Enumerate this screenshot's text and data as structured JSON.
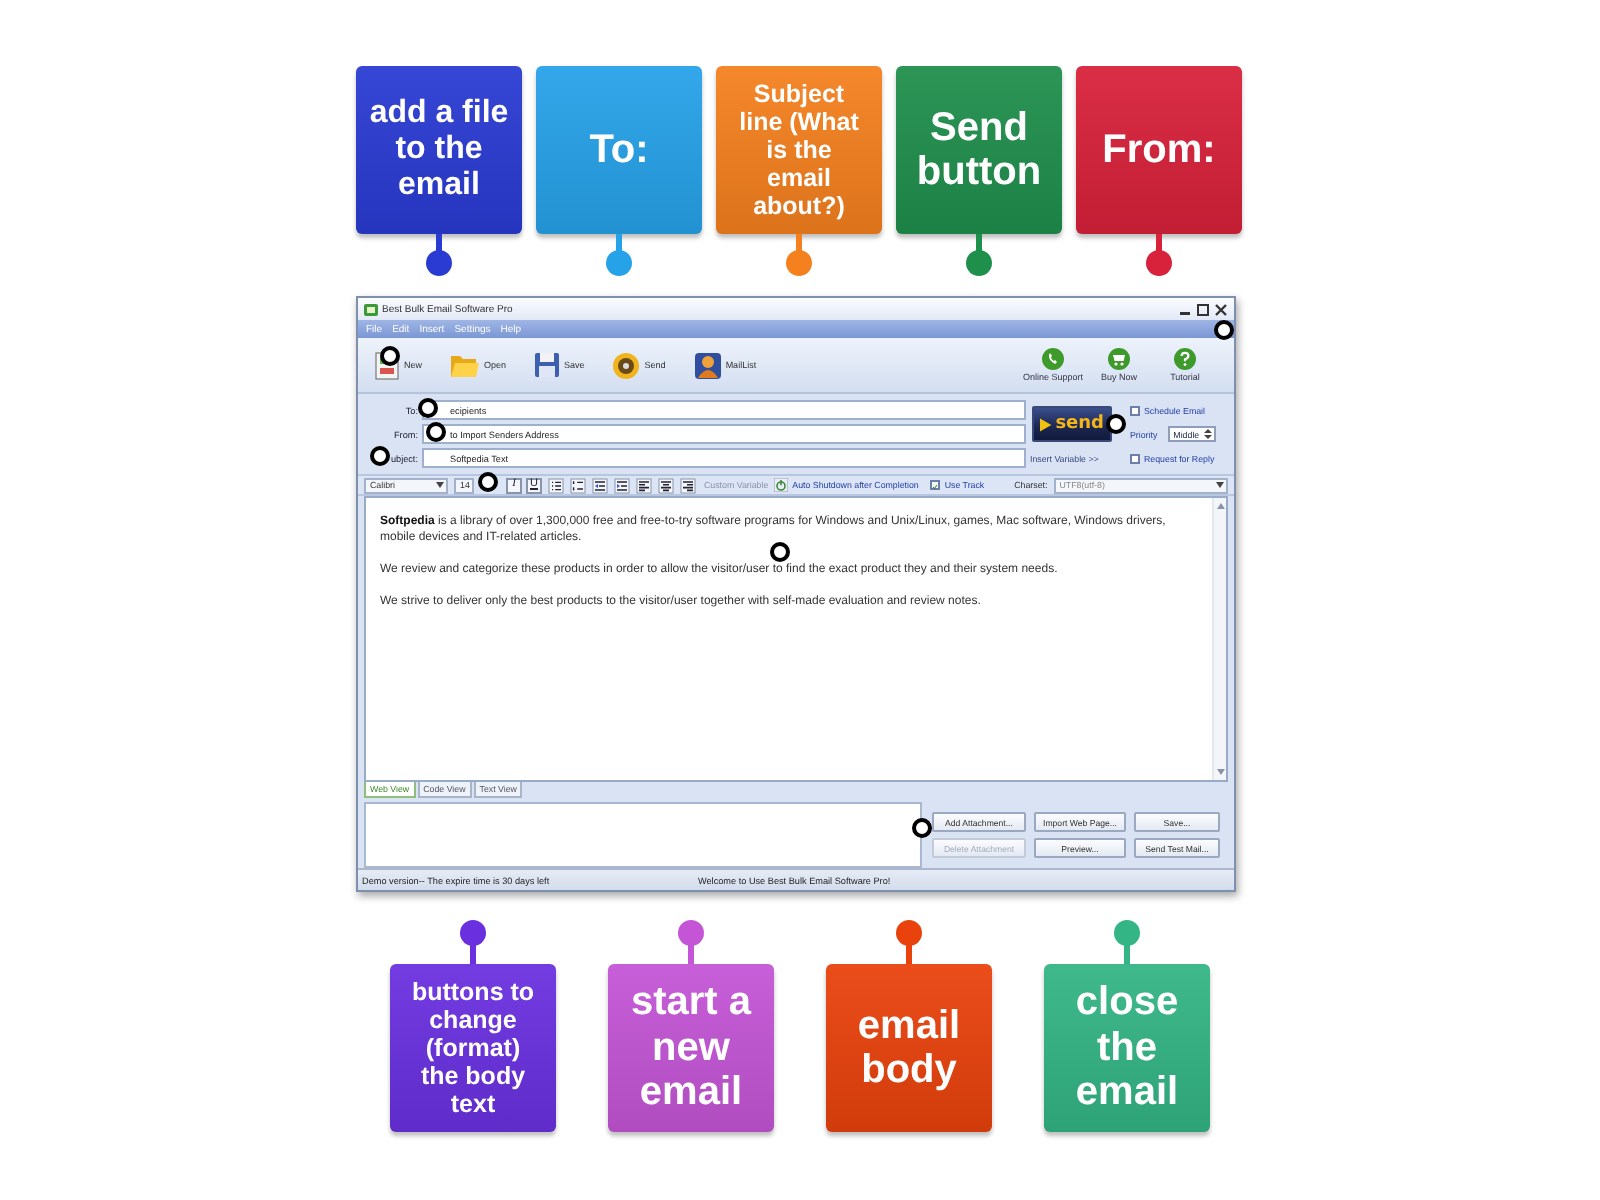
{
  "top_labels": [
    {
      "text": "add a file to the email",
      "color": "#2a3bd3"
    },
    {
      "text": "To:",
      "color": "#26a2e9"
    },
    {
      "text": "Subject line (What is the email about?)",
      "color": "#f5801e"
    },
    {
      "text": "Send button",
      "color": "#1f8f4c"
    },
    {
      "text": "From:",
      "color": "#d8213a"
    }
  ],
  "window": {
    "title": "Best Bulk Email Software Pro",
    "menu": [
      "File",
      "Edit",
      "Insert",
      "Settings",
      "Help"
    ],
    "toolbar": [
      {
        "kind": "new",
        "label": "New"
      },
      {
        "kind": "open",
        "label": "Open"
      },
      {
        "kind": "save",
        "label": "Save"
      },
      {
        "kind": "send",
        "label": "Send"
      },
      {
        "kind": "maillist",
        "label": "MailList"
      }
    ],
    "toolbar_right": [
      {
        "kind": "support",
        "label": "Online Support"
      },
      {
        "kind": "buy",
        "label": "Buy Now"
      },
      {
        "kind": "tutorial",
        "label": "Tutorial"
      }
    ],
    "fields": [
      {
        "label": "To:",
        "value": "ecipients"
      },
      {
        "label": "From:",
        "value": "to Import Senders Address"
      },
      {
        "label": "ubject:",
        "value": "Softpedia Text"
      }
    ],
    "send_button": "send",
    "insert_variable": "Insert Variable >>",
    "options": {
      "schedule": {
        "label": "Schedule Email",
        "checked": false
      },
      "priority_label": "Priority",
      "priority": "Middle",
      "request_reply": {
        "label": "Request for Reply",
        "checked": false
      }
    },
    "format_bar": {
      "font": "Calibri",
      "size": "14",
      "buttons": [
        {
          "kind": "italic",
          "label": "I"
        },
        {
          "kind": "underline",
          "label": "U"
        },
        {
          "kind": "bullets"
        },
        {
          "kind": "numbering"
        },
        {
          "kind": "outdent"
        },
        {
          "kind": "indent"
        },
        {
          "kind": "align-left"
        },
        {
          "kind": "align-center"
        },
        {
          "kind": "align-right"
        }
      ],
      "custom_variable": "Custom Variable",
      "auto_shutdown": "Auto Shutdown after Completion",
      "use_track": {
        "label": "Use Track",
        "checked": true
      },
      "charset_label": "Charset:",
      "charset": "UTF8(utf-8)"
    },
    "body": [
      "**Softpedia** is a library of over 1,300,000 free and free-to-try software programs for Windows and Unix/Linux, games, Mac software, Windows drivers, mobile devices and IT-related articles.",
      "We review and categorize these products in order to allow the visitor/user to find the exact product they and their system needs.",
      "We strive to deliver only the best products to the visitor/user together with self-made evaluation and review notes."
    ],
    "view_tabs": [
      {
        "label": "Web View",
        "selected": true
      },
      {
        "label": "Code View",
        "selected": false
      },
      {
        "label": "Text View",
        "selected": false
      }
    ],
    "buttons": [
      {
        "label": "Add Attachment...",
        "disabled": false
      },
      {
        "label": "Import Web Page...",
        "disabled": false
      },
      {
        "label": "Save...",
        "disabled": false
      },
      {
        "label": "Delete Attachment",
        "disabled": true
      },
      {
        "label": "Preview...",
        "disabled": false
      },
      {
        "label": "Send Test Mail...",
        "disabled": false
      }
    ],
    "status_bar": [
      "Demo version-- The expire time is 30 days left",
      "Welcome to Use Best Bulk Email Software Pro!"
    ]
  },
  "bottom_labels": [
    {
      "text": "buttons to change (format) the body text",
      "color": "#6a30e0"
    },
    {
      "text": "start a new email",
      "color": "#c455d6"
    },
    {
      "text": "email body",
      "color": "#e9420c"
    },
    {
      "text": "close the email",
      "color": "#33b585"
    }
  ]
}
